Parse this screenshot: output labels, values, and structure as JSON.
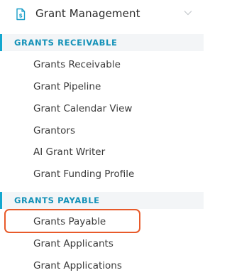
{
  "header": {
    "title": "Grant Management",
    "icon": "dollar-document-icon",
    "chevron": "chevron-down-icon"
  },
  "sections": [
    {
      "label": "GRANTS RECEIVABLE",
      "items": [
        "Grants Receivable",
        "Grant Pipeline",
        "Grant Calendar View",
        "Grantors",
        "AI Grant Writer",
        "Grant Funding Profile"
      ]
    },
    {
      "label": "GRANTS PAYABLE",
      "items": [
        "Grants Payable",
        "Grant Applicants",
        "Grant Applications"
      ]
    }
  ],
  "colors": {
    "accent": "#13a7cf",
    "section_text": "#1592b8",
    "section_bg": "#f3f5f7",
    "highlight": "#e85a2a"
  },
  "highlighted_item": "Grants Payable"
}
